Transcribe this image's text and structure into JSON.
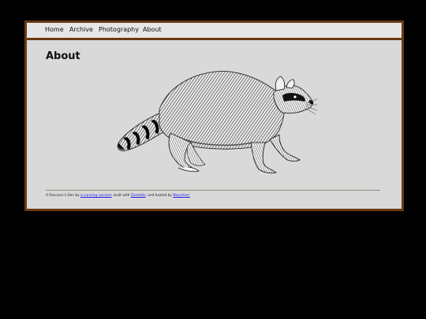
{
  "nav": {
    "items": [
      "Home",
      "Archive",
      "Photography",
      "About"
    ]
  },
  "page": {
    "title": "About"
  },
  "illustration": {
    "icon": "raccoon-illustration"
  },
  "footer": {
    "text_1": "A Raccoon's Den by ",
    "link_1": "a cunning raccoon",
    "text_2": ". built with ",
    "link_2": "Zonelets",
    "text_3": ", and hosted by ",
    "link_3": "Neocities!"
  },
  "colors": {
    "page_bg": "#000000",
    "frame_border": "#6b3a10",
    "content_bg": "#d9d9d9",
    "nav_bg": "#e6e6e6",
    "link": "#1a1aee"
  }
}
